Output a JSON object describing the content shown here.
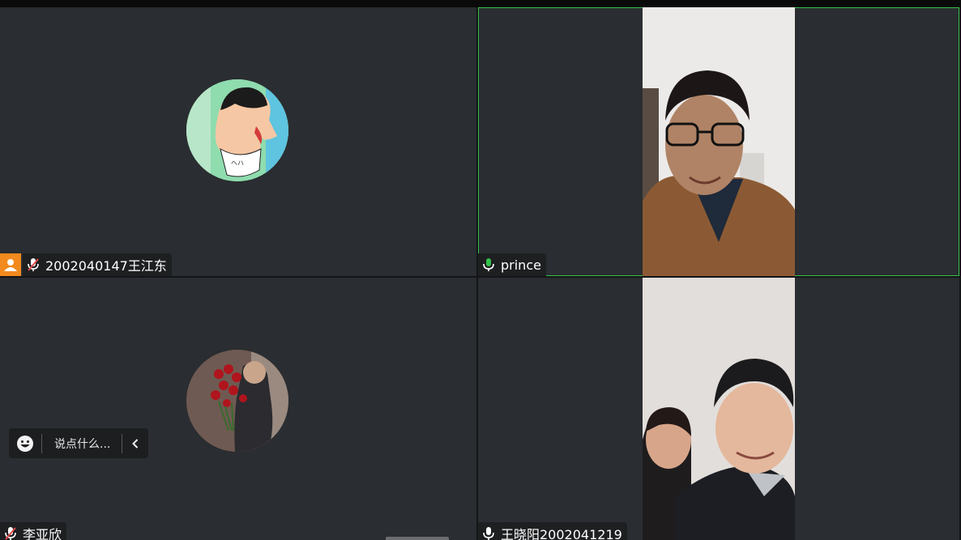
{
  "participants": [
    {
      "name": "2002040147王江东",
      "muted": true,
      "host": true,
      "video": false
    },
    {
      "name": "prince",
      "muted": false,
      "host": false,
      "video": true,
      "speaking": true
    },
    {
      "name": "李亚欣",
      "muted": true,
      "host": false,
      "video": false
    },
    {
      "name": "王晓阳2002041219",
      "muted": false,
      "host": false,
      "video": true
    }
  ],
  "chat": {
    "placeholder": "说点什么...",
    "emoji_icon": "smiley-icon",
    "collapse_icon": "chevron-left-icon"
  },
  "colors": {
    "tile_bg": "#2a2d31",
    "active_border": "#35c04a",
    "host_badge": "#f28a1d",
    "mic_active": "#35c04a",
    "mic_muted": "#e24a4a"
  }
}
